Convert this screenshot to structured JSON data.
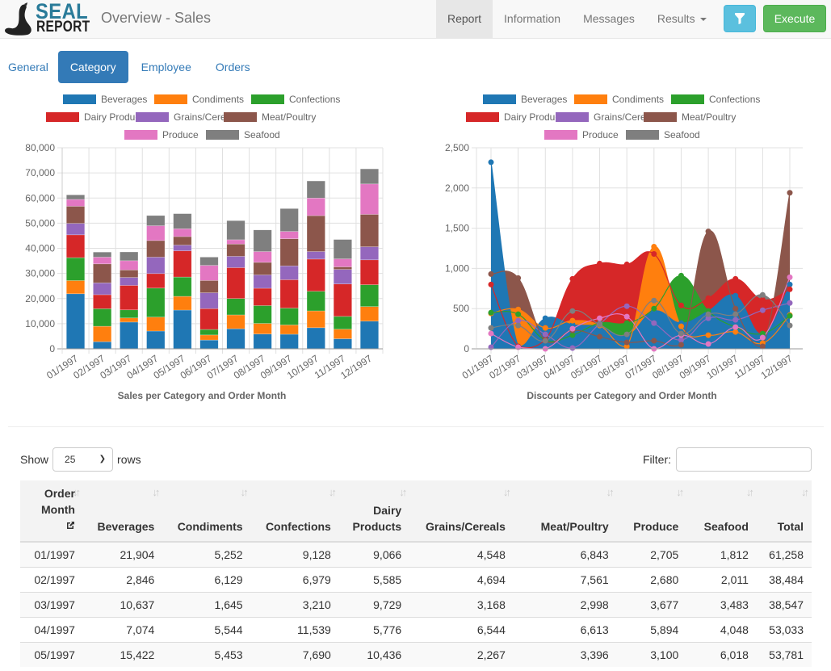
{
  "navbar": {
    "logo_top": "SEAL",
    "logo_bottom": "REPORT",
    "title": "Overview - Sales",
    "items": [
      {
        "label": "Report",
        "active": true
      },
      {
        "label": "Information",
        "active": false
      },
      {
        "label": "Messages",
        "active": false
      },
      {
        "label": "Results",
        "active": false,
        "dropdown": true
      }
    ],
    "filter_icon": "filter-icon",
    "execute_label": "Execute"
  },
  "tabs": [
    {
      "label": "General",
      "active": false
    },
    {
      "label": "Category",
      "active": true
    },
    {
      "label": "Employee",
      "active": false
    },
    {
      "label": "Orders",
      "active": false
    }
  ],
  "colors": {
    "Beverages": "#1f77b4",
    "Condiments": "#ff7f0e",
    "Confections": "#2ca02c",
    "Dairy Products": "#d62728",
    "Grains/Cereals": "#9467bd",
    "Meat/Poultry": "#8c564b",
    "Produce": "#e377c2",
    "Seafood": "#7f7f7f",
    "primary": "#337ab7",
    "info": "#5bc0de",
    "success": "#5cb85c"
  },
  "chart_data": [
    {
      "type": "bar",
      "stacked": true,
      "title": "Sales per Category and Order Month",
      "xlabel": "",
      "ylabel": "",
      "ylim": [
        0,
        80000
      ],
      "yticks": [
        "0",
        "10,000",
        "20,000",
        "30,000",
        "40,000",
        "50,000",
        "60,000",
        "70,000",
        "80,000"
      ],
      "legend": "top",
      "grid": true,
      "categories": [
        "01/1997",
        "02/1997",
        "03/1997",
        "04/1997",
        "05/1997",
        "06/1997",
        "07/1997",
        "08/1997",
        "09/1997",
        "10/1997",
        "11/1997",
        "12/1997"
      ],
      "series": [
        {
          "name": "Beverages",
          "values": [
            21904,
            2846,
            10637,
            7074,
            15422,
            3500,
            8000,
            5900,
            5800,
            8400,
            4000,
            11000
          ]
        },
        {
          "name": "Condiments",
          "values": [
            5252,
            6129,
            1645,
            5544,
            5453,
            2000,
            5500,
            4200,
            3700,
            6700,
            3800,
            5800
          ]
        },
        {
          "name": "Confections",
          "values": [
            9128,
            6979,
            3210,
            11539,
            7690,
            2200,
            6500,
            7100,
            6700,
            7800,
            5100,
            8700
          ]
        },
        {
          "name": "Dairy Products",
          "values": [
            9066,
            5585,
            9729,
            5776,
            10436,
            8300,
            12300,
            6900,
            11300,
            12800,
            12900,
            9900
          ]
        },
        {
          "name": "Grains/Cereals",
          "values": [
            4548,
            4694,
            3168,
            6544,
            2267,
            6300,
            4500,
            5300,
            5500,
            3000,
            5800,
            5200
          ]
        },
        {
          "name": "Meat/Poultry",
          "values": [
            6843,
            7561,
            2998,
            6613,
            3396,
            4900,
            4900,
            5000,
            10800,
            14300,
            1000,
            12900
          ]
        },
        {
          "name": "Produce",
          "values": [
            2705,
            2680,
            3677,
            5894,
            3100,
            6000,
            1700,
            4300,
            2900,
            7000,
            3200,
            12100
          ]
        },
        {
          "name": "Seafood",
          "values": [
            1812,
            2011,
            3483,
            4048,
            6018,
            3300,
            7600,
            8600,
            9100,
            6800,
            7700,
            6000
          ]
        }
      ]
    },
    {
      "type": "area",
      "stacked": false,
      "title": "Discounts per Category and Order Month",
      "xlabel": "",
      "ylabel": "",
      "ylim": [
        0,
        2500
      ],
      "yticks": [
        "0",
        "500",
        "1,000",
        "1,500",
        "2,000",
        "2,500"
      ],
      "legend": "top",
      "grid": true,
      "categories": [
        "01/1997",
        "02/1997",
        "03/1997",
        "04/1997",
        "05/1997",
        "06/1997",
        "07/1997",
        "08/1997",
        "09/1997",
        "10/1997",
        "11/1997",
        "12/1997"
      ],
      "series": [
        {
          "name": "Beverages",
          "values": [
            2320,
            30,
            380,
            300,
            280,
            160,
            470,
            320,
            470,
            660,
            180,
            800
          ]
        },
        {
          "name": "Condiments",
          "values": [
            440,
            490,
            260,
            350,
            290,
            30,
            1270,
            280,
            170,
            210,
            70,
            420
          ]
        },
        {
          "name": "Confections",
          "values": [
            450,
            430,
            110,
            170,
            320,
            320,
            500,
            910,
            470,
            270,
            190,
            410
          ]
        },
        {
          "name": "Dairy Products",
          "values": [
            800,
            30,
            110,
            870,
            1060,
            1050,
            1180,
            540,
            630,
            870,
            610,
            740
          ]
        },
        {
          "name": "Grains/Cereals",
          "values": [
            20,
            350,
            180,
            10,
            310,
            530,
            320,
            110,
            380,
            360,
            480,
            570
          ]
        },
        {
          "name": "Meat/Poultry",
          "values": [
            930,
            880,
            100,
            230,
            150,
            80,
            100,
            50,
            1460,
            500,
            30,
            1940
          ]
        },
        {
          "name": "Produce",
          "values": [
            190,
            20,
            0,
            250,
            380,
            400,
            0,
            170,
            60,
            270,
            140,
            890
          ]
        },
        {
          "name": "Seafood",
          "values": [
            260,
            290,
            100,
            470,
            300,
            180,
            600,
            190,
            430,
            430,
            670,
            290
          ]
        }
      ]
    }
  ],
  "table_controls": {
    "show_label": "Show",
    "rows_value": "25",
    "rows_label": "rows",
    "filter_label": "Filter:",
    "filter_value": "",
    "filter_placeholder": ""
  },
  "table": {
    "headers": [
      {
        "label": "Order Month",
        "has_link_icon": true
      },
      {
        "label": "Beverages"
      },
      {
        "label": "Condiments"
      },
      {
        "label": "Confections"
      },
      {
        "label": "Dairy Products"
      },
      {
        "label": "Grains/Cereals"
      },
      {
        "label": "Meat/Poultry"
      },
      {
        "label": "Produce"
      },
      {
        "label": "Seafood"
      },
      {
        "label": "Total"
      }
    ],
    "rows": [
      [
        "01/1997",
        "21,904",
        "5,252",
        "9,128",
        "9,066",
        "4,548",
        "6,843",
        "2,705",
        "1,812",
        "61,258"
      ],
      [
        "02/1997",
        "2,846",
        "6,129",
        "6,979",
        "5,585",
        "4,694",
        "7,561",
        "2,680",
        "2,011",
        "38,484"
      ],
      [
        "03/1997",
        "10,637",
        "1,645",
        "3,210",
        "9,729",
        "3,168",
        "2,998",
        "3,677",
        "3,483",
        "38,547"
      ],
      [
        "04/1997",
        "7,074",
        "5,544",
        "11,539",
        "5,776",
        "6,544",
        "6,613",
        "5,894",
        "4,048",
        "53,033"
      ],
      [
        "05/1997",
        "15,422",
        "5,453",
        "7,690",
        "10,436",
        "2,267",
        "3,396",
        "3,100",
        "6,018",
        "53,781"
      ]
    ]
  }
}
